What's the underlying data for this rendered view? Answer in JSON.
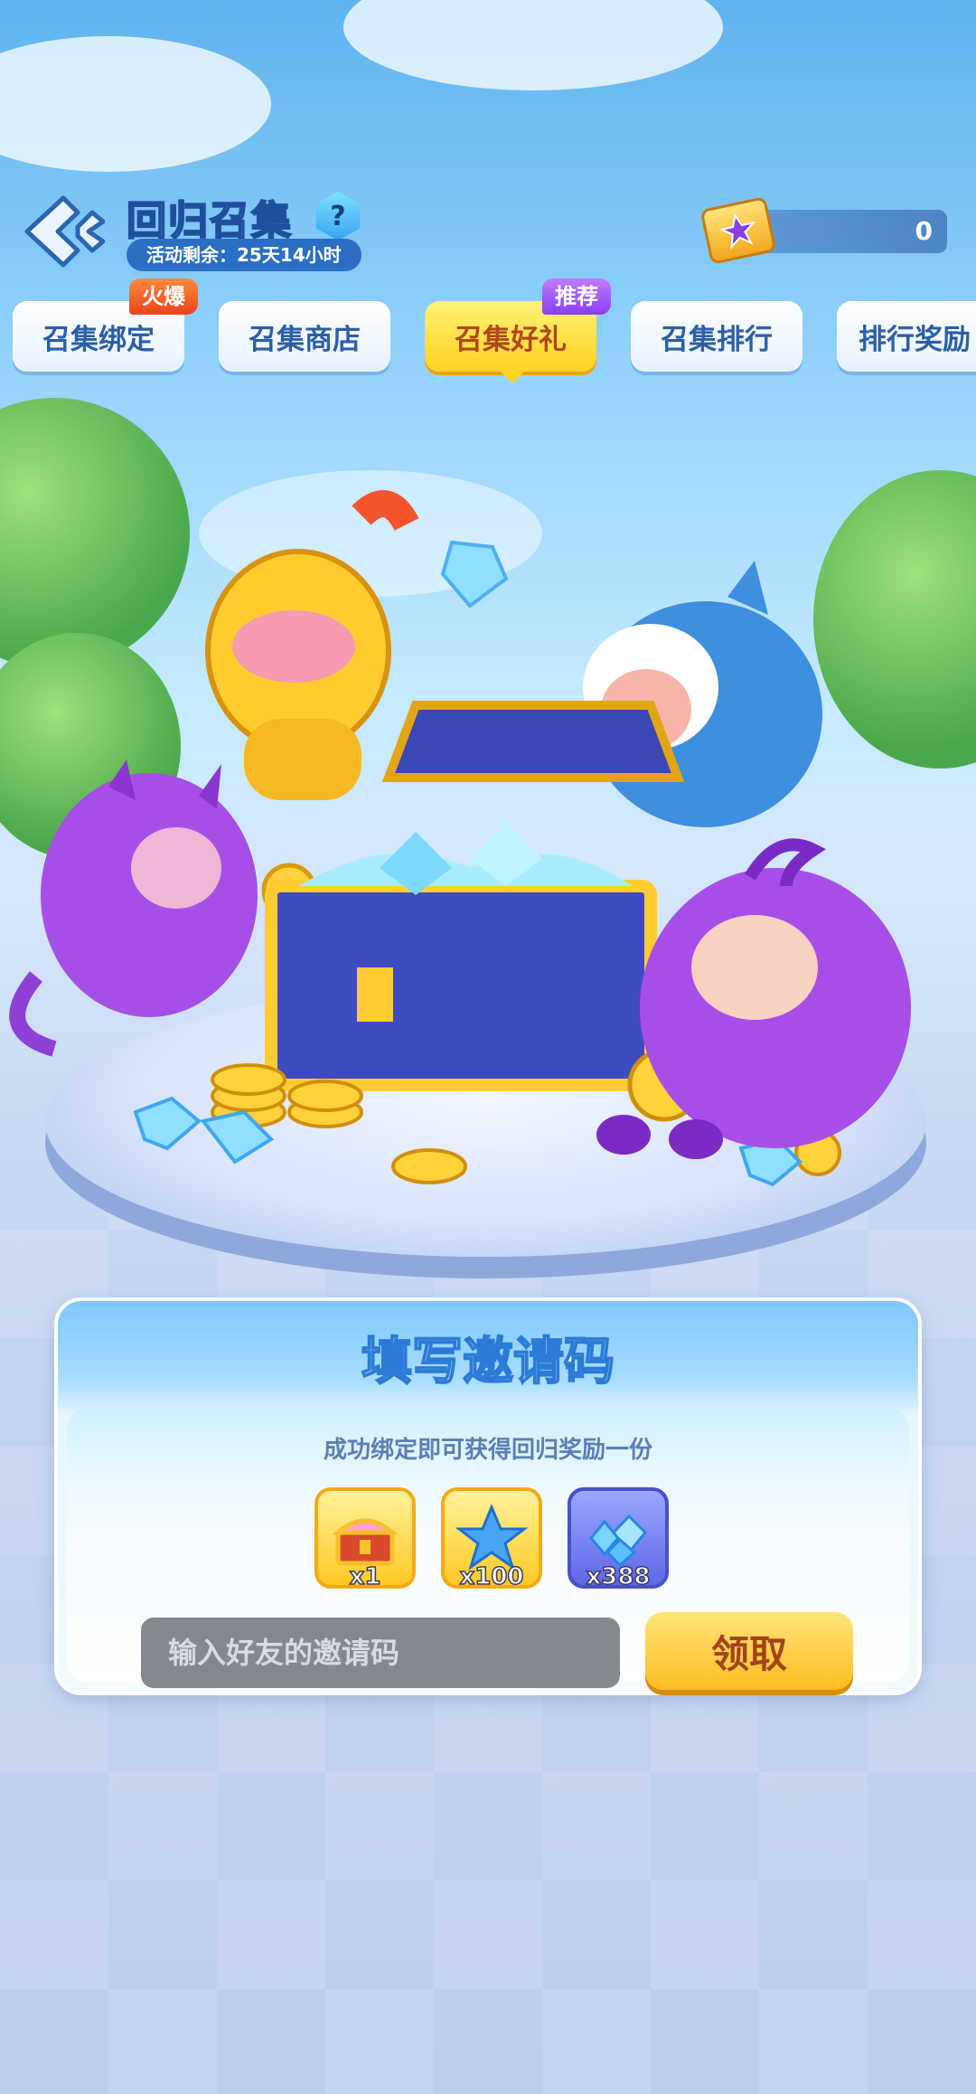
{
  "header": {
    "title": "回归召集",
    "help_label": "?",
    "countdown": "活动剩余：25天14小时",
    "currency_value": "0"
  },
  "tabs": [
    {
      "label": "召集绑定",
      "badge": "火爆"
    },
    {
      "label": "召集商店"
    },
    {
      "label": "召集好礼",
      "badge": "推荐",
      "active": true
    },
    {
      "label": "召集排行"
    },
    {
      "label": "排行奖励"
    }
  ],
  "invite_card": {
    "title": "填写邀请码",
    "subtitle": "成功绑定即可获得回归奖励一份",
    "rewards": [
      {
        "icon": "treasure-chest-icon",
        "qty": "x1"
      },
      {
        "icon": "blue-star-icon",
        "qty": "x100"
      },
      {
        "icon": "diamond-gems-icon",
        "qty": "x388"
      }
    ],
    "input_placeholder": "输入好友的邀请码",
    "claim_label": "领取"
  },
  "colors": {
    "accent_yellow": "#ffd21e",
    "tab_text": "#2b5ea6",
    "badge_hot": "#e9431e",
    "badge_recommend": "#8a3ff0"
  }
}
